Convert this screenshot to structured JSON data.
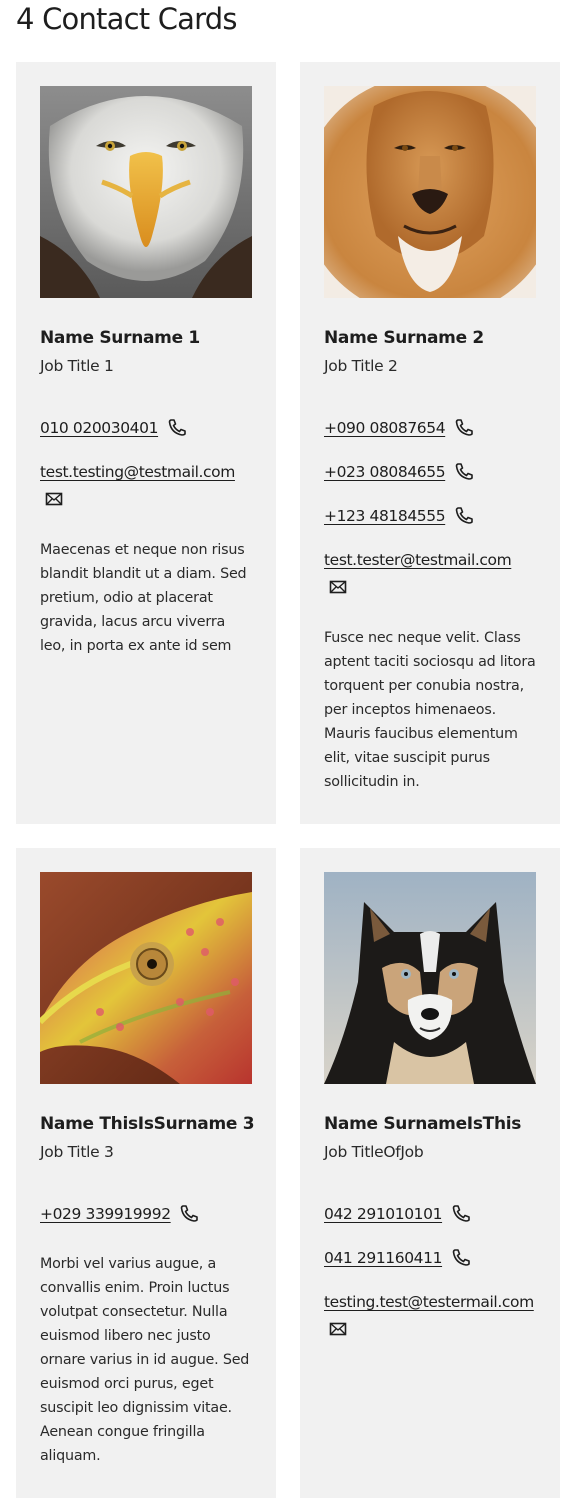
{
  "page": {
    "title": "4 Contact Cards"
  },
  "icons": {
    "phone": "phone-icon",
    "email": "envelope-icon"
  },
  "cards": [
    {
      "photo": "bald-eagle-photo",
      "name": "Name Surname 1",
      "job": "Job Title 1",
      "phones": [
        "010 020030401"
      ],
      "email": "test.testing@testmail.com",
      "description": "Maecenas et neque non risus blandit blandit ut a diam. Sed pretium, odio at placerat gravida, lacus arcu viverra leo, in porta ex ante id sem"
    },
    {
      "photo": "lion-photo",
      "name": "Name Surname 2",
      "job": "Job Title 2",
      "phones": [
        "+090 08087654",
        "+023 08084655",
        "+123 48184555"
      ],
      "email": "test.tester@testmail.com",
      "description": "Fusce nec neque velit. Class aptent taciti sociosqu ad litora torquent per conubia nostra, per inceptos himenaeos. Mauris faucibus elementum elit, vitae suscipit purus sollicitudin in."
    },
    {
      "photo": "chameleon-photo",
      "name": "Name ThisIsSurname 3",
      "job": "Job Title 3",
      "phones": [
        "+029 339919992"
      ],
      "email": "",
      "description": "Morbi vel varius augue, a convallis enim. Proin luctus volutpat consectetur. Nulla euismod libero nec justo ornare varius in id augue. Sed euismod orci purus, eget suscipit leo dignissim vitae. Aenean congue fringilla aliquam."
    },
    {
      "photo": "husky-photo",
      "name": "Name SurnameIsThis",
      "job": "Job TitleOfJob",
      "phones": [
        "042 291010101",
        "041 291160411"
      ],
      "email": "testing.test@testermail.com",
      "description": ""
    }
  ]
}
